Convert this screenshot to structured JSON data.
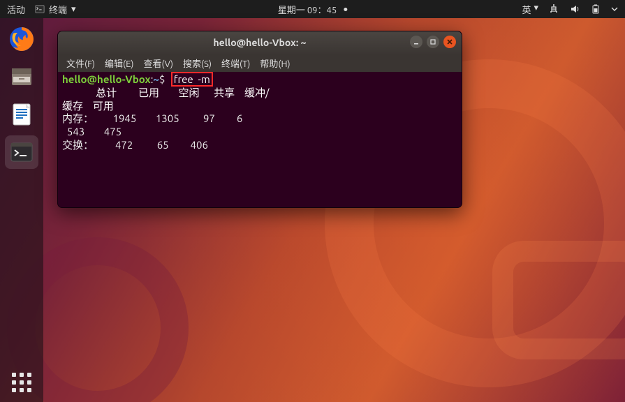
{
  "topbar": {
    "activities": "活动",
    "app_indicator": "终端",
    "clock": "星期一 09：45",
    "ime": "英",
    "ime_caret": "▾"
  },
  "dock": {
    "items": [
      {
        "name": "firefox"
      },
      {
        "name": "files"
      },
      {
        "name": "libreoffice-writer"
      },
      {
        "name": "terminal"
      }
    ]
  },
  "window": {
    "title": "hello@hello-Vbox: ~",
    "menu": {
      "file": "文件(F)",
      "edit": "编辑(E)",
      "view": "查看(V)",
      "search": "搜索(S)",
      "terminal": "终端(T)",
      "help": "帮助(H)"
    }
  },
  "terminal": {
    "prompt_user": "hello@hello-Vbox",
    "prompt_sep": ":",
    "prompt_path": "~",
    "prompt_symbol": "$",
    "command": "free  -m",
    "headers": {
      "total": "总计",
      "used": "已用",
      "free": "空闲",
      "shared": "共享",
      "buff": "缓冲/",
      "cache": "缓存",
      "available": "可用"
    },
    "rows": {
      "mem_label": "内存：",
      "mem_total": "1945",
      "mem_used": "1305",
      "mem_free": "97",
      "mem_shared": "6",
      "mem_buff": "543",
      "mem_avail": "475",
      "swap_label": "交换：",
      "swap_total": "472",
      "swap_used": "65",
      "swap_free": "406"
    }
  }
}
